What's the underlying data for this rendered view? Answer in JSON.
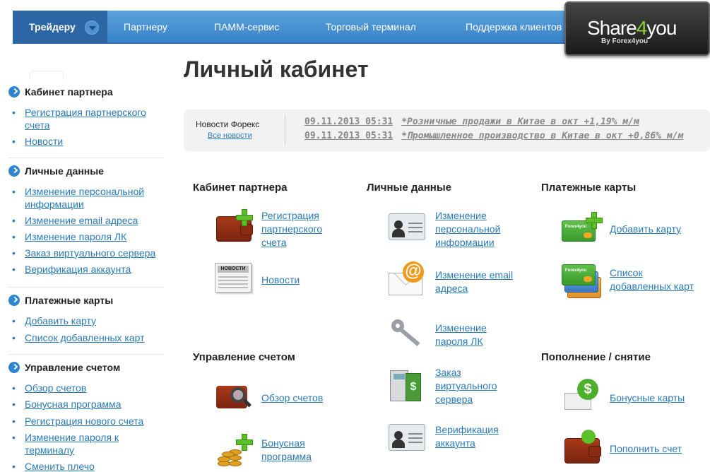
{
  "topnav": {
    "items": [
      "Трейдеру",
      "Партнеру",
      "ПАММ-сервис",
      "Торговый терминал",
      "Поддержка клиентов"
    ]
  },
  "brand": {
    "logo_main_a": "Share",
    "logo_main_b": "4",
    "logo_main_c": "you",
    "logo_sub": "By Forex4you"
  },
  "sidebar": {
    "sections": [
      {
        "title": "Кабинет партнера",
        "items": [
          "Регистрация партнерского счета",
          "Новости"
        ]
      },
      {
        "title": "Личные данные",
        "items": [
          "Изменение персональной информации",
          "Изменение email адреса",
          "Изменение пароля ЛК",
          "Заказ виртуального сервера",
          "Верификация аккаунта"
        ]
      },
      {
        "title": "Платежные карты",
        "items": [
          "Добавить карту",
          "Список добавленных карт"
        ]
      },
      {
        "title": "Управление счетом",
        "items": [
          "Обзор счетов",
          "Бонусная программа",
          "Регистрация нового счета",
          "Изменение пароля к терминалу",
          "Сменить плечо"
        ]
      }
    ]
  },
  "page_title": "Личный кабинет",
  "news": {
    "label": "Новости Форекс",
    "all_link": "Все новости",
    "items": [
      {
        "date": "09.11.2013 05:31",
        "text": "*Розничные продажи в Китае в окт +1,19% м/м"
      },
      {
        "date": "09.11.2013 05:31",
        "text": "*Промышленное производство в Китае в окт +0,86% м/м"
      }
    ]
  },
  "groups": {
    "partner": {
      "title": "Кабинет партнера",
      "items": [
        "Регистрация партнерского счета",
        "Новости"
      ]
    },
    "personal": {
      "title": "Личные данные",
      "items": [
        "Изменение персональной информации",
        "Изменение email адреса",
        "Изменение пароля ЛК",
        "Заказ виртуального сервера",
        "Верификация аккаунта"
      ]
    },
    "cards": {
      "title": "Платежные карты",
      "items": [
        "Добавить карту",
        "Список добавленных карт"
      ]
    },
    "account": {
      "title": "Управление счетом",
      "items": [
        "Обзор счетов",
        "Бонусная программа"
      ]
    },
    "funding": {
      "title": "Пополнение / снятие",
      "items": [
        "Бонусные карты",
        "Пополнить счет"
      ]
    }
  },
  "icon_labels": {
    "newspaper": "НОВОСТИ",
    "card": "Forex4you",
    "dollar": "$",
    "at": "@"
  }
}
